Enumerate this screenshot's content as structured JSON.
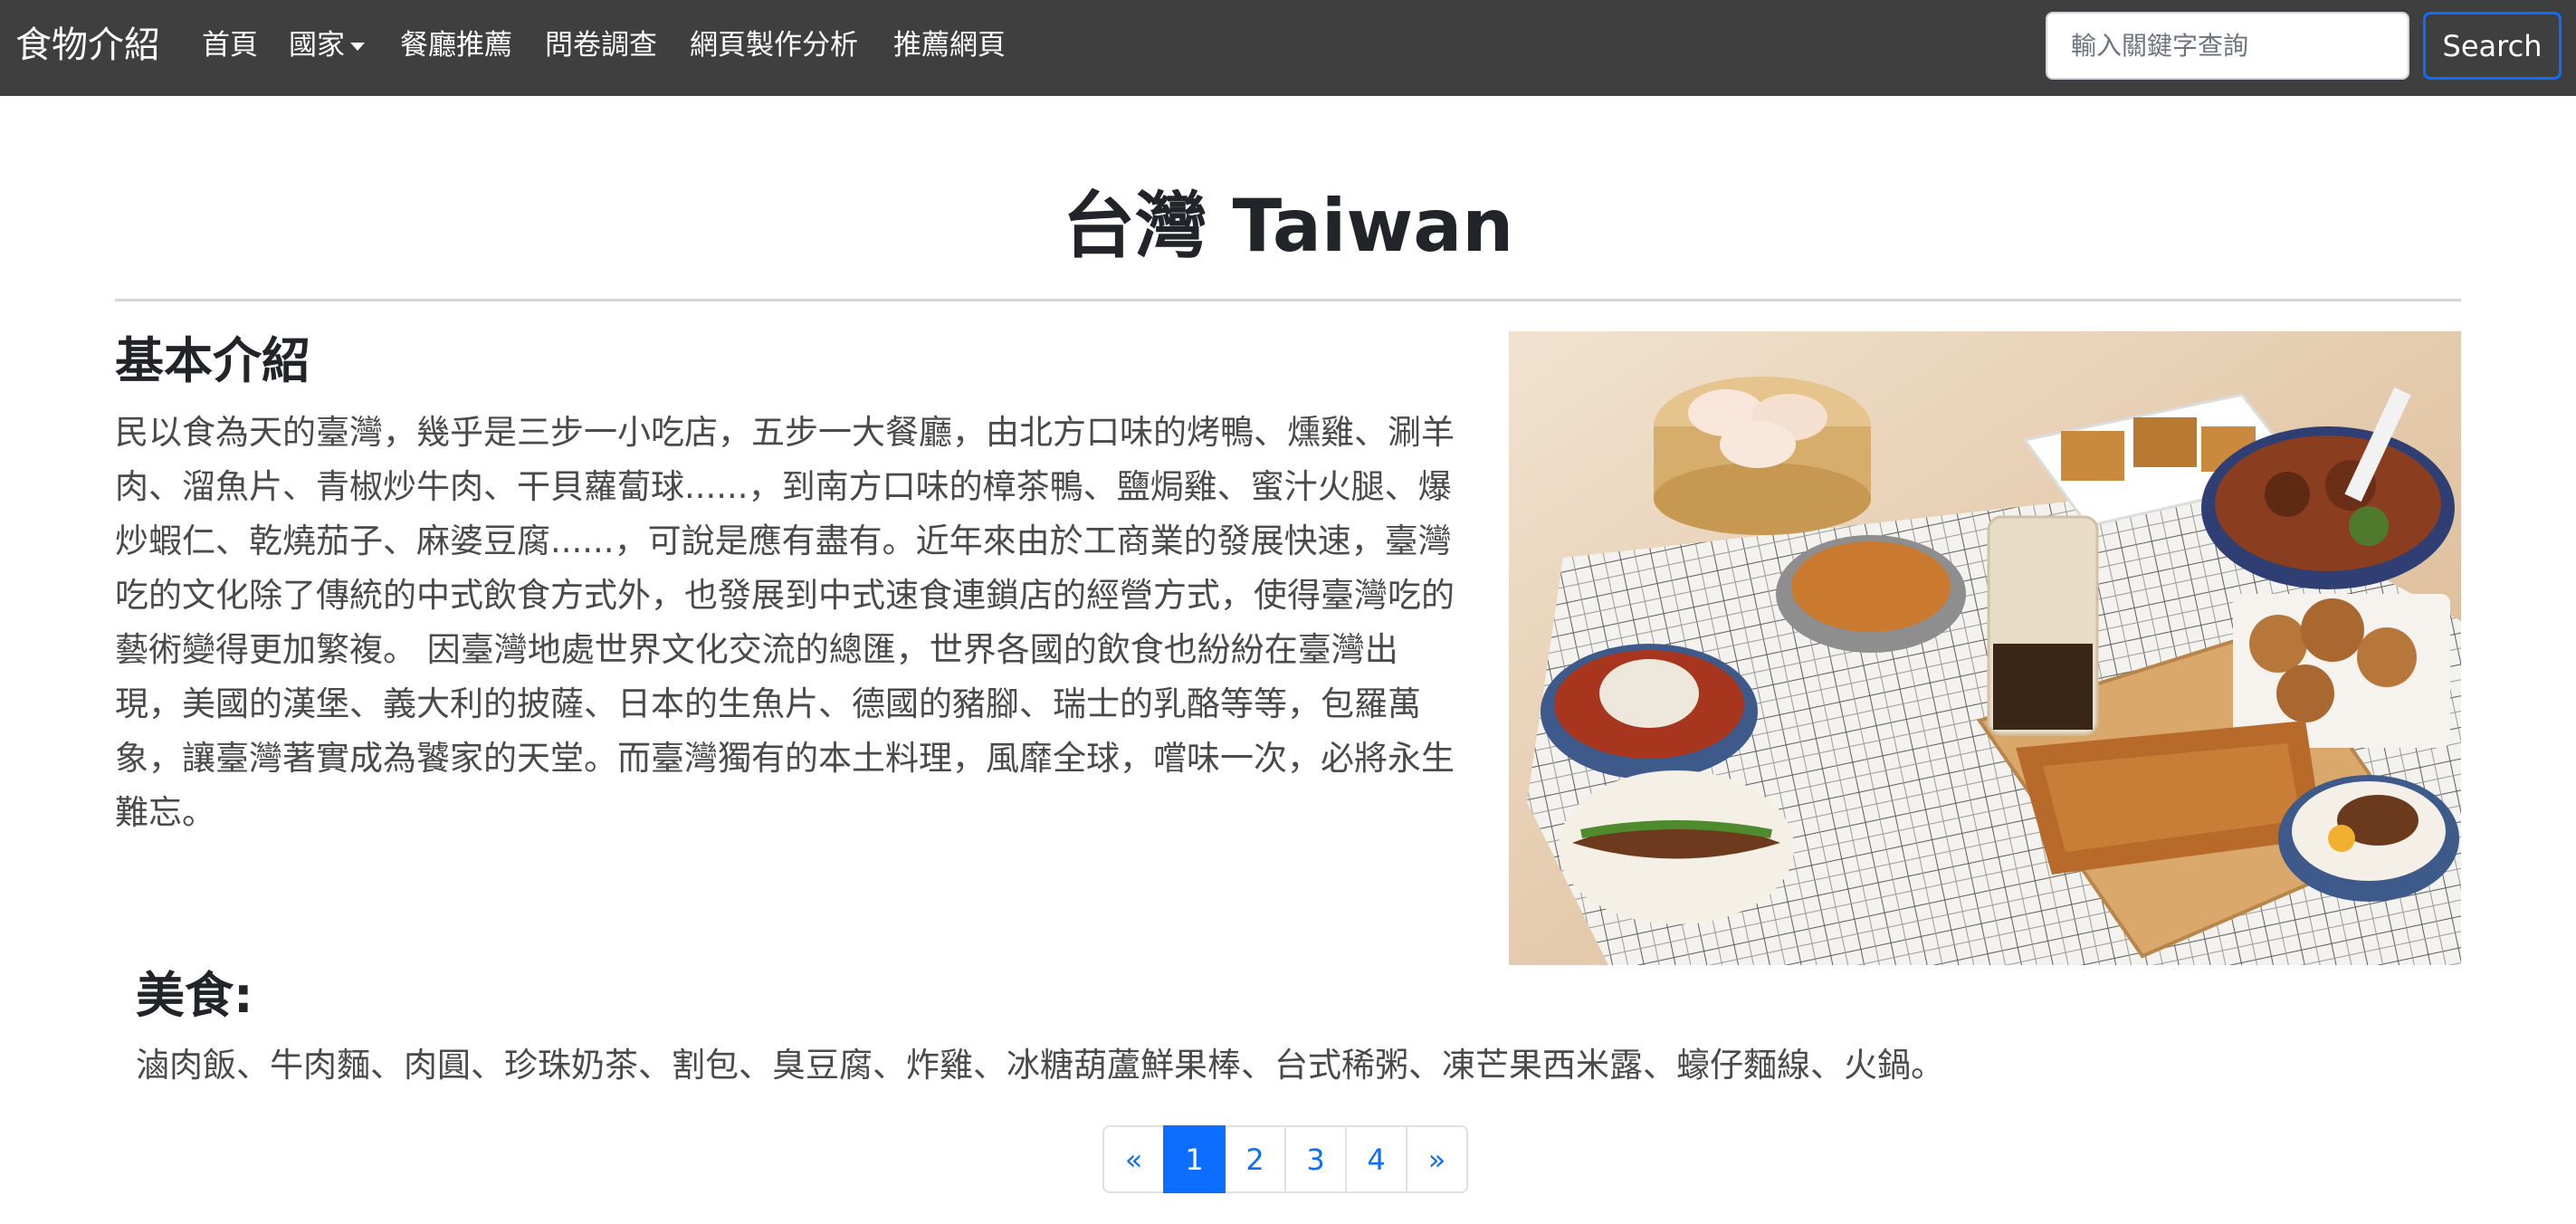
{
  "navbar": {
    "brand": "食物介紹",
    "items": [
      {
        "label": "首頁"
      },
      {
        "label": "國家"
      },
      {
        "label": "餐廳推薦"
      },
      {
        "label": "問卷調查"
      },
      {
        "label": "網頁製作分析"
      },
      {
        "label": "推薦網頁"
      }
    ],
    "search_placeholder": "輸入關鍵字查詢",
    "search_value": "",
    "search_button": "Search"
  },
  "page": {
    "title": "台灣 Taiwan"
  },
  "intro": {
    "heading": "基本介紹",
    "paragraph": "民以食為天的臺灣，幾乎是三步一小吃店，五步一大餐廳，由北方口味的烤鴨、燻雞、涮羊肉、溜魚片、青椒炒牛肉、干貝蘿蔔球......，到南方口味的樟茶鴨、鹽焗雞、蜜汁火腿、爆炒蝦仁、乾燒茄子、麻婆豆腐......，可說是應有盡有。近年來由於工商業的發展快速，臺灣吃的文化除了傳統的中式飲食方式外，也發展到中式速食連鎖店的經營方式，使得臺灣吃的藝術變得更加繁複。 因臺灣地處世界文化交流的總匯，世界各國的飲食也紛紛在臺灣出現，美國的漢堡、義大利的披薩、日本的生魚片、德國的豬腳、瑞士的乳酪等等，包羅萬象，讓臺灣著實成為饕家的天堂。而臺灣獨有的本土料理，風靡全球，嚐味一次，必將永生難忘。"
  },
  "foods": {
    "heading": "美食:",
    "list": "滷肉飯、牛肉麵、肉圓、珍珠奶茶、割包、臭豆腐、炸雞、冰糖葫蘆鮮果棒、台式稀粥、凍芒果西米露、蠔仔麵線、火鍋。"
  },
  "pagination": {
    "prev": "«",
    "pages": [
      "1",
      "2",
      "3",
      "4"
    ],
    "active_page": "1",
    "next": "»"
  },
  "colors": {
    "navbar_bg": "#3f3f3f",
    "accent": "#0d6efd",
    "text": "#212529",
    "body_text": "#4a4a4a"
  }
}
